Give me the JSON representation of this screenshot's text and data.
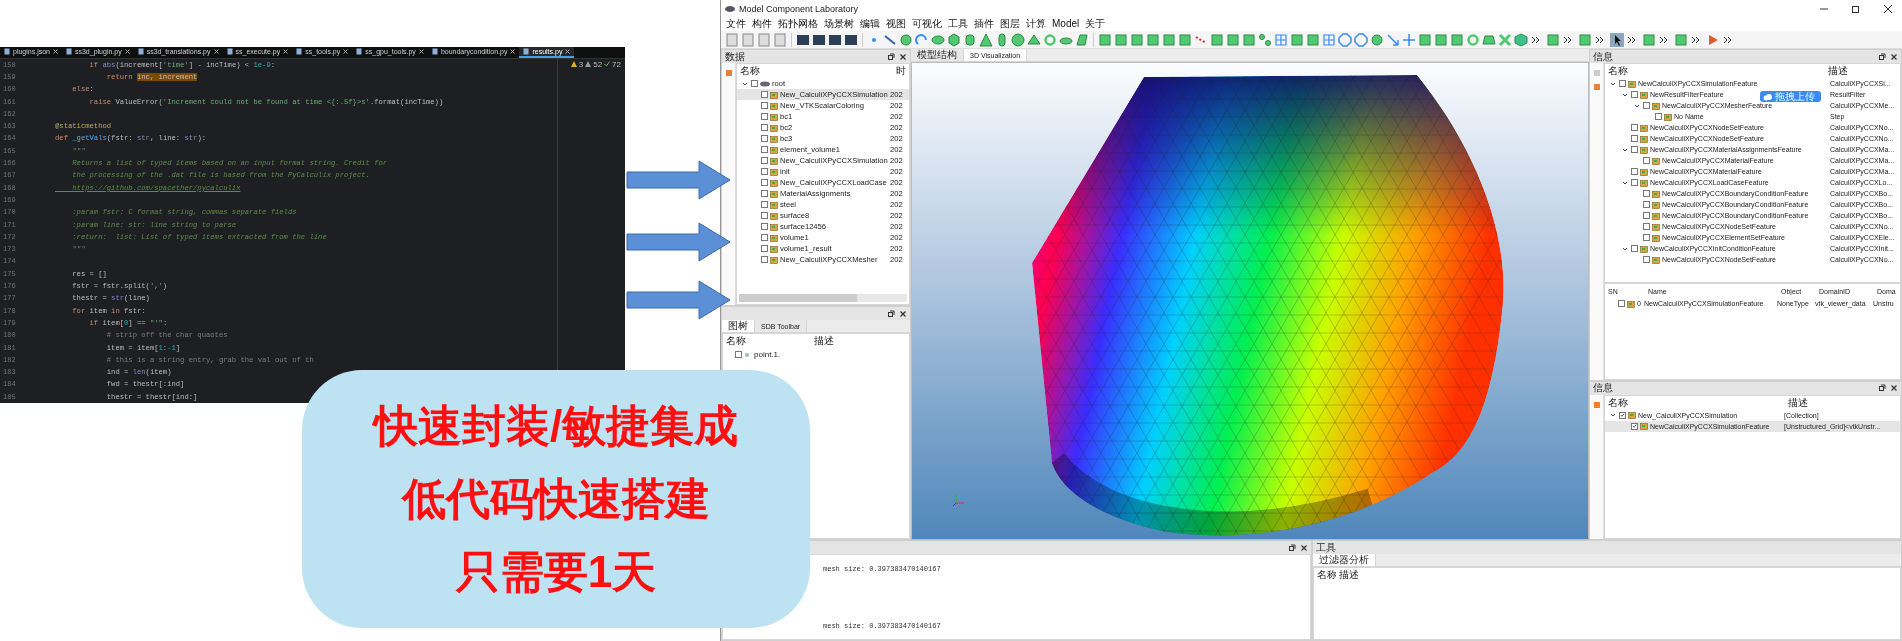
{
  "editor": {
    "tabs": [
      {
        "label": "plugins.json",
        "selected": false
      },
      {
        "label": "ss3d_plugin.py",
        "selected": false
      },
      {
        "label": "ss3d_translations.py",
        "selected": false
      },
      {
        "label": "ss_execute.py",
        "selected": false
      },
      {
        "label": "ss_tools.py",
        "selected": false
      },
      {
        "label": "ss_gpu_tools.py",
        "selected": false
      },
      {
        "label": "boundarycondition.py",
        "selected": false
      },
      {
        "label": "results.py",
        "selected": true
      }
    ],
    "inspections": {
      "warnings": "3",
      "weak_warnings": "52",
      "passed": "72"
    },
    "lines": [
      {
        "no": "158",
        "segments": [
          {
            "kind": "kw",
            "t": "        if"
          },
          {
            "kind": "builtin",
            "t": " abs"
          },
          {
            "kind": "plain",
            "t": "(increment["
          },
          {
            "kind": "str",
            "t": "'time'"
          },
          {
            "kind": "plain",
            "t": "] - incTime) < "
          },
          {
            "kind": "num",
            "t": "1e-9"
          },
          {
            "kind": "plain",
            "t": ":"
          }
        ]
      },
      {
        "no": "159",
        "segments": [
          {
            "kind": "kw",
            "t": "            return "
          },
          {
            "kind": "hl",
            "t": "inc, increment"
          }
        ]
      },
      {
        "no": "160",
        "segments": [
          {
            "kind": "kw",
            "t": "    else"
          },
          {
            "kind": "plain",
            "t": ":"
          }
        ]
      },
      {
        "no": "161",
        "segments": [
          {
            "kind": "kw",
            "t": "        raise"
          },
          {
            "kind": "plain",
            "t": " ValueError("
          },
          {
            "kind": "str",
            "t": "'Increment could not be found at time <{:.5f}>s'"
          },
          {
            "kind": "plain",
            "t": ".format(incTime))"
          }
        ]
      },
      {
        "no": "162"
      },
      {
        "no": "163",
        "segments": [
          {
            "kind": "deco",
            "t": "@staticmethod"
          }
        ]
      },
      {
        "no": "164",
        "segments": [
          {
            "kind": "kw",
            "t": "def "
          },
          {
            "kind": "fn",
            "t": "_getVals"
          },
          {
            "kind": "plain",
            "t": "(fstr: "
          },
          {
            "kind": "builtin",
            "t": "str"
          },
          {
            "kind": "plain",
            "t": ", line: "
          },
          {
            "kind": "builtin",
            "t": "str"
          },
          {
            "kind": "plain",
            "t": "):"
          }
        ]
      },
      {
        "no": "165",
        "segments": [
          {
            "kind": "doc",
            "t": "    \"\"\""
          }
        ]
      },
      {
        "no": "166",
        "segments": [
          {
            "kind": "doc",
            "t": "    Returns a list of typed items based on an input format string. Credit for"
          }
        ]
      },
      {
        "no": "167",
        "segments": [
          {
            "kind": "doc",
            "t": "    the processing of the .dat file is based from the PyCalculix project."
          }
        ]
      },
      {
        "no": "168",
        "segments": [
          {
            "kind": "link",
            "t": "    https://github.com/spacether/pycalculix"
          }
        ]
      },
      {
        "no": "169"
      },
      {
        "no": "170",
        "segments": [
          {
            "kind": "doc",
            "t": "    :param fstr: C format string, commas separate fields"
          }
        ]
      },
      {
        "no": "171",
        "segments": [
          {
            "kind": "doc",
            "t": "    :param line: str: line string to parse"
          }
        ]
      },
      {
        "no": "172",
        "segments": [
          {
            "kind": "doc",
            "t": "    :return:  list: List of typed items extracted from the line"
          }
        ]
      },
      {
        "no": "173",
        "segments": [
          {
            "kind": "doc",
            "t": "    \"\"\""
          }
        ]
      },
      {
        "no": "174"
      },
      {
        "no": "175",
        "segments": [
          {
            "kind": "plain",
            "t": "    res = []"
          }
        ]
      },
      {
        "no": "176",
        "segments": [
          {
            "kind": "plain",
            "t": "    fstr = fstr.split("
          },
          {
            "kind": "str",
            "t": "','"
          },
          {
            "kind": "plain",
            "t": ")"
          }
        ]
      },
      {
        "no": "177",
        "segments": [
          {
            "kind": "plain",
            "t": "    thestr = "
          },
          {
            "kind": "builtin",
            "t": "str"
          },
          {
            "kind": "plain",
            "t": "(line)"
          }
        ]
      },
      {
        "no": "178",
        "segments": [
          {
            "kind": "kw",
            "t": "    for"
          },
          {
            "kind": "plain",
            "t": " item "
          },
          {
            "kind": "kw",
            "t": "in"
          },
          {
            "kind": "plain",
            "t": " fstr:"
          }
        ]
      },
      {
        "no": "179",
        "segments": [
          {
            "kind": "kw",
            "t": "        if"
          },
          {
            "kind": "plain",
            "t": " item["
          },
          {
            "kind": "num",
            "t": "0"
          },
          {
            "kind": "plain",
            "t": "] == "
          },
          {
            "kind": "str",
            "t": "\"'\""
          },
          {
            "kind": "plain",
            "t": ":"
          }
        ]
      },
      {
        "no": "180",
        "segments": [
          {
            "kind": "cmt",
            "t": "            # strip off the char quaotes"
          }
        ]
      },
      {
        "no": "181",
        "segments": [
          {
            "kind": "plain",
            "t": "            item = item["
          },
          {
            "kind": "num",
            "t": "1"
          },
          {
            "kind": "plain",
            "t": ":"
          },
          {
            "kind": "num",
            "t": "-1"
          },
          {
            "kind": "plain",
            "t": "]"
          }
        ]
      },
      {
        "no": "182",
        "segments": [
          {
            "kind": "cmt",
            "t": "            # this is a string entry, grab the val out of th"
          }
        ]
      },
      {
        "no": "183",
        "segments": [
          {
            "kind": "plain",
            "t": "            ind = "
          },
          {
            "kind": "builtin",
            "t": "len"
          },
          {
            "kind": "plain",
            "t": "(item)"
          }
        ]
      },
      {
        "no": "184",
        "segments": [
          {
            "kind": "plain",
            "t": "            fwd = thestr[:ind]"
          }
        ]
      },
      {
        "no": "185",
        "segments": [
          {
            "kind": "plain",
            "t": "            thestr = thestr[ind:]"
          }
        ]
      }
    ]
  },
  "promo_card": {
    "lines": [
      "快速封装/敏捷集成",
      "低代码快速搭建",
      "只需要1天"
    ]
  },
  "app": {
    "window": {
      "title": "Model Component Laboratory"
    },
    "menu": [
      "文件",
      "构件",
      "拓扑网格",
      "场景树",
      "编辑",
      "视图",
      "可视化",
      "工具",
      "插件",
      "图层",
      "计算",
      "Model",
      "关于"
    ],
    "data_dock": {
      "title": "数据",
      "columns": [
        "名称",
        "时"
      ],
      "root": {
        "name": "root",
        "checked": false,
        "expanded": true,
        "children": [
          {
            "name": "New_CalculiXPyCCXSimulation",
            "time": "202",
            "checked": false,
            "selected": true
          },
          {
            "name": "New_VTKScalarColoring",
            "time": "202",
            "checked": false,
            "selected": false
          },
          {
            "name": "bc1",
            "time": "202",
            "checked": false,
            "selected": false
          },
          {
            "name": "bc2",
            "time": "202",
            "checked": false,
            "selected": false
          },
          {
            "name": "bc3",
            "time": "202",
            "checked": false,
            "selected": false
          },
          {
            "name": "element_volume1",
            "time": "202",
            "checked": false,
            "selected": false
          },
          {
            "name": "New_CalculiXPyCCXSimulation",
            "time": "202",
            "checked": false,
            "selected": false
          },
          {
            "name": "init",
            "time": "202",
            "checked": false,
            "selected": false
          },
          {
            "name": "New_CalculiXPyCCXLoadCase",
            "time": "202",
            "checked": false,
            "selected": false
          },
          {
            "name": "MaterialAssignments",
            "time": "202",
            "checked": false,
            "selected": false
          },
          {
            "name": "steel",
            "time": "202",
            "checked": false,
            "selected": false
          },
          {
            "name": "surface8",
            "time": "202",
            "checked": false,
            "selected": false
          },
          {
            "name": "surface12456",
            "time": "202",
            "checked": false,
            "selected": false
          },
          {
            "name": "volume1",
            "time": "202",
            "checked": false,
            "selected": false
          },
          {
            "name": "volume1_result",
            "time": "202",
            "checked": false,
            "selected": false
          },
          {
            "name": "New_CalculiXPyCCXMesher",
            "time": "202",
            "checked": false,
            "selected": false
          }
        ]
      }
    },
    "graph_dock": {
      "tabs": [
        {
          "label": "图树",
          "selected": true
        },
        {
          "label": "SDB Toolbar",
          "selected": false
        }
      ],
      "columns": [
        "名称",
        "描述"
      ],
      "rows": [
        {
          "name": "point.1.",
          "checked": false
        }
      ]
    },
    "viewport": {
      "tabs": [
        {
          "label": "模型结构",
          "selected": false
        },
        {
          "label": "3D Visualization",
          "selected": true
        }
      ]
    },
    "info_dock": {
      "title": "信息",
      "columns": [
        "名称",
        "描述"
      ],
      "upload_badge": "拖拽上传",
      "tree": [
        {
          "name": "NewCalculiXPyCCXSimulationFeature",
          "desc": "CalculiXPyCCXSi...",
          "checked": false,
          "expanded": true,
          "children": [
            {
              "name": "NewResultFilterFeature",
              "desc": "ResultFilter",
              "checked": false,
              "expanded": true,
              "children": [
                {
                  "name": "NewCalculiXPyCCXMesherFeature",
                  "desc": "CalculiXPyCCXMe...",
                  "checked": false,
                  "expanded": true,
                  "children": [
                    {
                      "name": "No Name",
                      "desc": "Step",
                      "checked": false
                    }
                  ]
                }
              ]
            },
            {
              "name": "NewCalculiXPyCCXNodeSetFeature",
              "desc": "CalculiXPyCCXNo...",
              "checked": false
            },
            {
              "name": "NewCalculiXPyCCXNodeSetFeature",
              "desc": "CalculiXPyCCXNo...",
              "checked": false
            },
            {
              "name": "NewCalculiXPyCCXMaterialAssignmentsFeature",
              "desc": "CalculiXPyCCXMa...",
              "checked": false,
              "expanded": true,
              "children": [
                {
                  "name": "NewCalculiXPyCCXMaterialFeature",
                  "desc": "CalculiXPyCCXMa...",
                  "checked": false
                }
              ]
            },
            {
              "name": "NewCalculiXPyCCXMaterialFeature",
              "desc": "CalculiXPyCCXMa...",
              "checked": false
            },
            {
              "name": "NewCalculiXPyCCXLoadCaseFeature",
              "desc": "CalculiXPyCCXLo...",
              "checked": false,
              "expanded": true,
              "children": [
                {
                  "name": "NewCalculiXPyCCXBoundaryConditionFeature",
                  "desc": "CalculiXPyCCXBo...",
                  "checked": false
                },
                {
                  "name": "NewCalculiXPyCCXBoundaryConditionFeature",
                  "desc": "CalculiXPyCCXBo...",
                  "checked": false
                },
                {
                  "name": "NewCalculiXPyCCXBoundaryConditionFeature",
                  "desc": "CalculiXPyCCXBo...",
                  "checked": false
                },
                {
                  "name": "NewCalculiXPyCCXNodeSetFeature",
                  "desc": "CalculiXPyCCXNo...",
                  "checked": false
                },
                {
                  "name": "NewCalculiXPyCCXElementSetFeature",
                  "desc": "CalculiXPyCCXEle...",
                  "checked": false
                }
              ]
            },
            {
              "name": "NewCalculiXPyCCXInitConditionFeature",
              "desc": "CalculiXPyCCXInit...",
              "checked": false,
              "expanded": true,
              "children": [
                {
                  "name": "NewCalculiXPyCCXNodeSetFeature",
                  "desc": "CalculiXPyCCXNo...",
                  "checked": false
                }
              ]
            }
          ]
        }
      ],
      "table": {
        "columns": [
          "SN",
          "Name",
          "Object",
          "DomainID",
          "Doma"
        ],
        "rows": [
          {
            "checked": false,
            "cells": [
              "0",
              "NewCalculiXPyCCXSimulationFeature",
              "NoneType",
              "vtk_viewer_data",
              "Unstru"
            ]
          }
        ]
      }
    },
    "info_dock_2": {
      "title": "信息",
      "columns": [
        "名称",
        "描述"
      ],
      "tree": [
        {
          "name": "New_CalculiXPyCCXSimulation",
          "desc": "[Collection]",
          "checked": true,
          "selected": false,
          "expanded": true,
          "children": [
            {
              "name": "NewCalculiXPyCCXSimulationFeature",
              "desc": "[Unstructured_Grid]<vtkUnstr...",
              "checked": true,
              "selected": true
            }
          ]
        }
      ]
    },
    "log_dock": {
      "lines": [
        "mesh size:  0.397383470140167",
        "mesh size:  0.397383470140167"
      ]
    },
    "tools_dock": {
      "title": "工具",
      "tabs": [
        {
          "label": "过滤器分析",
          "selected": true
        }
      ],
      "columns": [
        "名称",
        "描述"
      ]
    }
  }
}
